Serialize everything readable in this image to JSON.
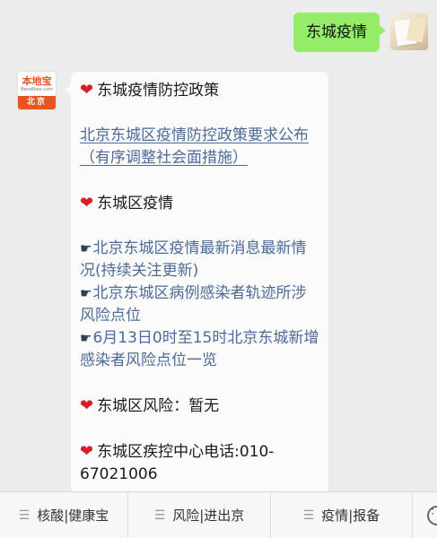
{
  "chat": {
    "outgoing": {
      "text": "东城疫情"
    },
    "incoming": {
      "avatar": {
        "brand": "本地宝",
        "site": "Bendibao.com",
        "city": "北京"
      },
      "lines": {
        "policy_heading": "东城疫情防控政策",
        "policy_link": "北京东城区疫情防控政策要求公布（有序调整社会面措施）",
        "epidemic_heading": "东城区疫情",
        "item1": "北京东城区疫情最新消息最新情况(持续关注更新)",
        "item2": "北京东城区病例感染者轨迹所涉风险点位",
        "item3": "6月13日0时至15时北京东城新增感染者风险点位一览",
        "risk_heading": "东城区风险：暂无",
        "phone_heading": "东城区疾控中心电话:010-67021006"
      }
    }
  },
  "menu": {
    "items": [
      {
        "label": "核酸|健康宝",
        "icon": "menu-lines-icon"
      },
      {
        "label": "风险|进出京",
        "icon": "menu-lines-icon"
      },
      {
        "label": "疫情|报备",
        "icon": "menu-lines-icon"
      }
    ],
    "keyboard_icon": "keyboard-toggle-icon"
  },
  "colors": {
    "background": "#ececec",
    "outgoing_bubble": "#95ec69",
    "incoming_bubble": "#fbfbfb",
    "link": "#4c6a9a",
    "heart": "#d81e2a",
    "brand_orange": "#e8541e"
  }
}
